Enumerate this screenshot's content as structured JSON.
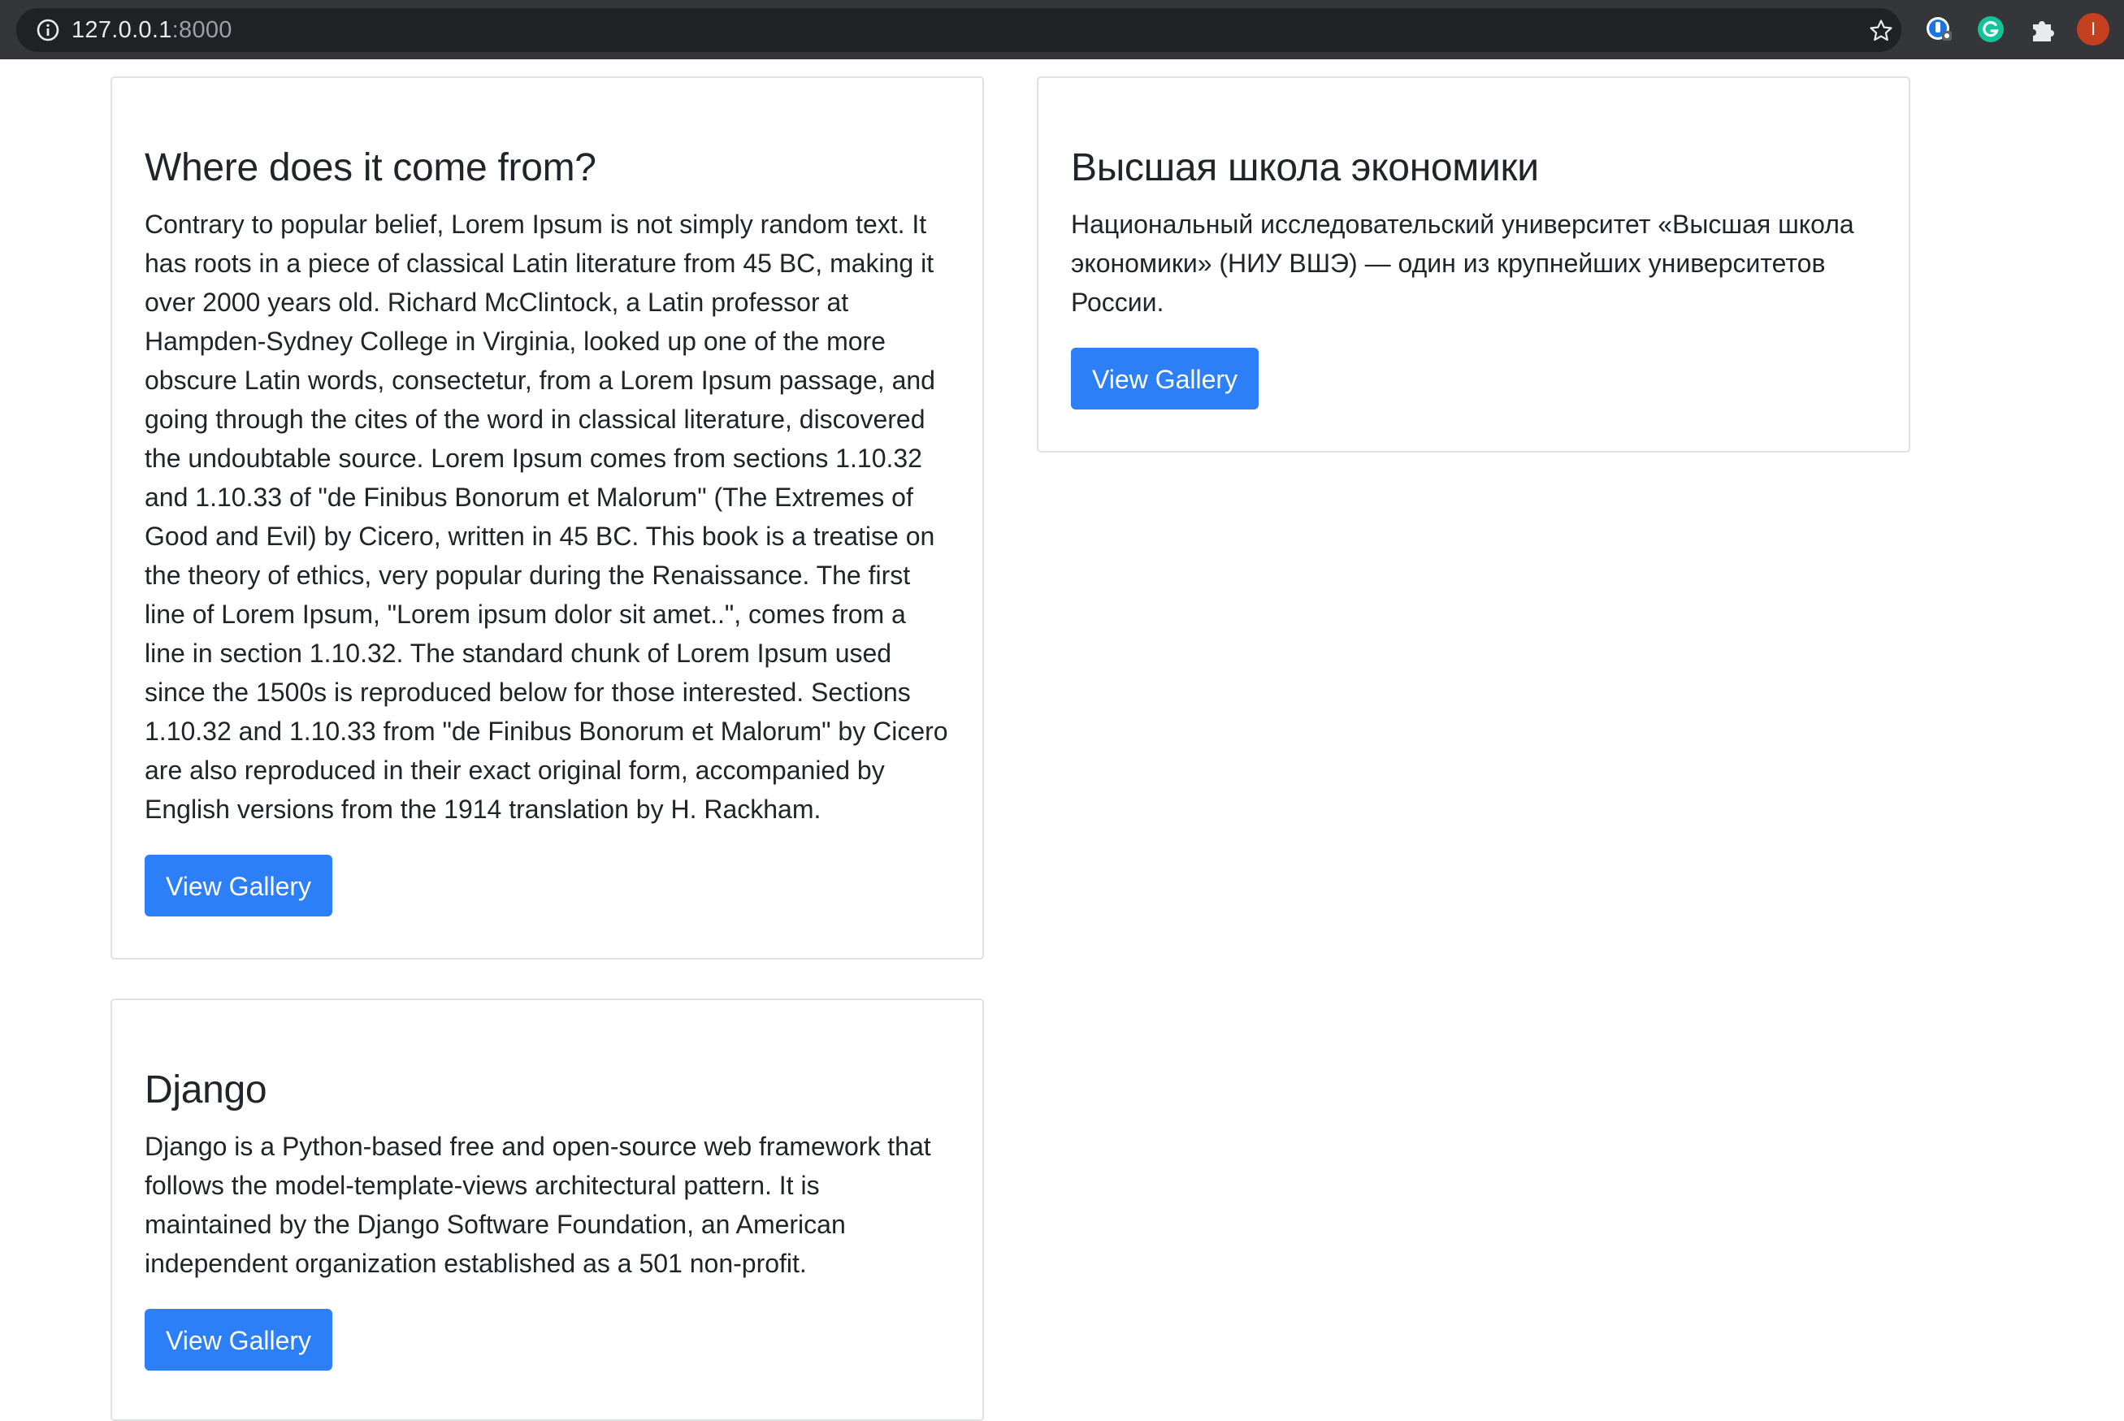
{
  "browser": {
    "url_host": "127.0.0.1",
    "url_port": ":8000",
    "profile_initial": "I"
  },
  "cards": [
    {
      "title": "Where does it come from?",
      "body": "Contrary to popular belief, Lorem Ipsum is not simply random text. It has roots in a piece of classical Latin literature from 45 BC, making it over 2000 years old. Richard McClintock, a Latin professor at Hampden-Sydney College in Virginia, looked up one of the more obscure Latin words, consectetur, from a Lorem Ipsum passage, and going through the cites of the word in classical literature, discovered the undoubtable source. Lorem Ipsum comes from sections 1.10.32 and 1.10.33 of \"de Finibus Bonorum et Malorum\" (The Extremes of Good and Evil) by Cicero, written in 45 BC. This book is a treatise on the theory of ethics, very popular during the Renaissance. The first line of Lorem Ipsum, \"Lorem ipsum dolor sit amet..\", comes from a line in section 1.10.32. The standard chunk of Lorem Ipsum used since the 1500s is reproduced below for those interested. Sections 1.10.32 and 1.10.33 from \"de Finibus Bonorum et Malorum\" by Cicero are also reproduced in their exact original form, accompanied by English versions from the 1914 translation by H. Rackham.",
      "button": "View Gallery"
    },
    {
      "title": "Высшая школа экономики",
      "body": "Национальный исследовательский университет «Высшая школа экономики» (НИУ ВШЭ) — один из крупнейших университетов России.",
      "button": "View Gallery"
    },
    {
      "title": "Django",
      "body": "Django is a Python-based free and open-source web framework that follows the model-template-views architectural pattern. It is maintained by the Django Software Foundation, an American independent organization established as a 501 non-profit.",
      "button": "View Gallery"
    }
  ],
  "colors": {
    "chrome_bg": "#35363a",
    "omnibox_bg": "#202124",
    "button_primary": "#2c7ff6",
    "text": "#212529"
  },
  "icons": [
    "info-icon",
    "bookmark-star-icon",
    "password-manager-icon",
    "grammarly-icon",
    "extensions-puzzle-icon"
  ]
}
